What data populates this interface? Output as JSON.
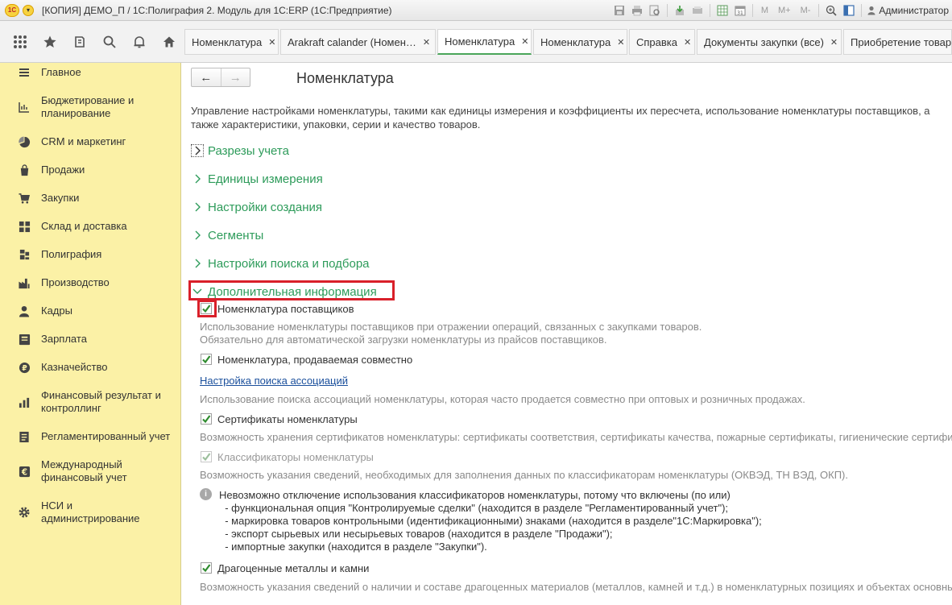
{
  "window": {
    "title": "[КОПИЯ] ДЕМО_П / 1С:Полиграфия 2. Модуль для 1С:ERP  (1С:Предприятие)",
    "logo_text": "1С",
    "user": "Администратор",
    "m_labels": [
      "M",
      "M+",
      "M-"
    ]
  },
  "tabs": [
    {
      "label": "Номенклатура",
      "close": "✕"
    },
    {
      "label": "Arakraft calander (Номен…",
      "close": "✕"
    },
    {
      "label": "Номенклатура",
      "close": "✕",
      "active": true
    },
    {
      "label": "Номенклатура",
      "close": "✕"
    },
    {
      "label": "Справка",
      "close": "✕"
    },
    {
      "label": "Документы закупки (все)",
      "close": "✕"
    },
    {
      "label": "Приобретение товаров",
      "close": ""
    }
  ],
  "sidebar": {
    "items": [
      {
        "label": "Главное",
        "icon": "menu-icon"
      },
      {
        "label": "Бюджетирование и планирование",
        "icon": "budget-icon"
      },
      {
        "label": "CRM и маркетинг",
        "icon": "crm-icon"
      },
      {
        "label": "Продажи",
        "icon": "sales-icon"
      },
      {
        "label": "Закупки",
        "icon": "cart-icon"
      },
      {
        "label": "Склад и доставка",
        "icon": "warehouse-icon"
      },
      {
        "label": "Полиграфия",
        "icon": "printing-icon"
      },
      {
        "label": "Производство",
        "icon": "factory-icon"
      },
      {
        "label": "Кадры",
        "icon": "person-icon"
      },
      {
        "label": "Зарплата",
        "icon": "salary-icon"
      },
      {
        "label": "Казначейство",
        "icon": "treasury-icon"
      },
      {
        "label": "Финансовый результат и контроллинг",
        "icon": "chart-icon"
      },
      {
        "label": "Регламентированный учет",
        "icon": "report-icon"
      },
      {
        "label": "Международный финансовый учет",
        "icon": "euro-icon"
      },
      {
        "label": "НСИ и администрирование",
        "icon": "gear-icon"
      }
    ]
  },
  "main": {
    "title": "Номенклатура",
    "back": "←",
    "forward": "→",
    "description": "Управление настройками номенклатуры, такими как единицы измерения и коэффициенты их пересчета, использование номенклатуры поставщиков, а также характеристики, упаковки, серии и качество товаров.",
    "sections": [
      "Разрезы учета",
      "Единицы измерения",
      "Настройки создания",
      "Сегменты",
      "Настройки поиска и подбора",
      "Дополнительная информация"
    ],
    "options": {
      "suppliers": {
        "label": "Номенклатура поставщиков",
        "checked": true,
        "hint1": "Использование номенклатуры поставщиков при отражении операций, связанных с закупками товаров.",
        "hint2": "Обязательно для автоматической загрузки номенклатуры из прайсов поставщиков."
      },
      "sold_together": {
        "label": "Номенклатура, продаваемая совместно",
        "checked": true,
        "link": "Настройка поиска ассоциаций",
        "hint": "Использование поиска ассоциаций номенклатуры, которая часто продается совместно при оптовых и розничных продажах."
      },
      "certificates": {
        "label": "Сертификаты номенклатуры",
        "checked": true,
        "hint": "Возможность хранения сертификатов номенклатуры: сертификаты соответствия, сертификаты качества, пожарные сертификаты, гигиенические сертификаты"
      },
      "classifiers": {
        "label": "Классификаторы номенклатуры",
        "checked": true,
        "disabled": true,
        "hint": "Возможность указания сведений, необходимых для заполнения данных по классификаторам номенклатуры (ОКВЭД, ТН ВЭД, ОКП).",
        "info_lines": [
          "Невозможно отключение использования классификаторов номенклатуры, потому что включены (по или)",
          "  - функциональная опция \"Контролируемые сделки\" (находится в разделе \"Регламентированный учет\");",
          "  - маркировка товаров контрольными (идентификационными) знаками (находится в разделе\"1С:Маркировка\");",
          "  - экспорт сырьевых или несырьевых товаров (находится в разделе \"Продажи\");",
          "  - импортные закупки (находится в разделе \"Закупки\")."
        ]
      },
      "precious": {
        "label": "Драгоценные металлы и камни",
        "checked": true,
        "hint": "Возможность указания сведений о наличии и составе драгоценных материалов (металлов, камней и т.д.) в номенклатурных позициях и объектах основных"
      }
    }
  },
  "colors": {
    "sidebar_bg": "#fbf1a6",
    "section_green": "#2d9b5a",
    "check_green": "#2e8b2e",
    "highlight_red": "#d9202a",
    "link_blue": "#1a4f9c"
  }
}
